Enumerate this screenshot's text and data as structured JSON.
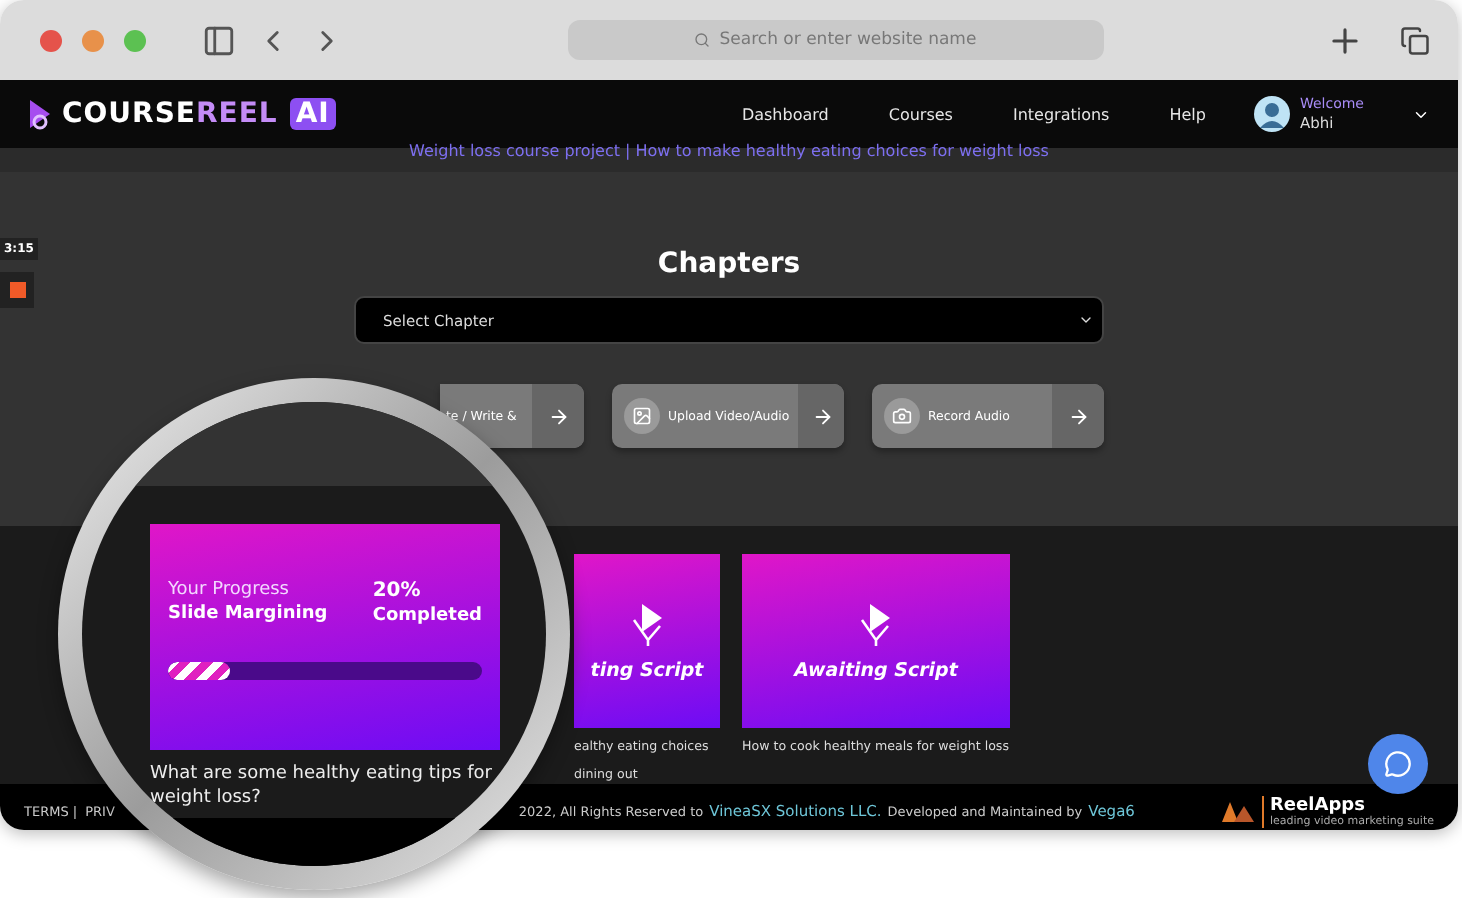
{
  "browser": {
    "address_placeholder": "Search or enter website name"
  },
  "nav": {
    "logo": {
      "part1": "COURSE",
      "part2": "REEL",
      "badge": "AI"
    },
    "links": [
      "Dashboard",
      "Courses",
      "Integrations",
      "Help"
    ],
    "user": {
      "greeting": "Welcome",
      "name": "Abhi"
    }
  },
  "project_title": "Weight loss course project | How to make healthy eating choices for weight loss",
  "recorder": {
    "timer": "3:15"
  },
  "chapters": {
    "title": "Chapters",
    "select_placeholder": "Select Chapter"
  },
  "actions": [
    {
      "kind": "write",
      "label": "te / Write &"
    },
    {
      "kind": "upload",
      "label": "Upload Video/Audio"
    },
    {
      "kind": "record",
      "label": "Record Audio"
    }
  ],
  "cards": [
    {
      "status": "ting Script",
      "caption_lines": [
        "ealthy eating choices",
        "dining out"
      ]
    },
    {
      "status": "Awaiting Script",
      "caption_lines": [
        "How to cook healthy meals for weight loss"
      ]
    }
  ],
  "magnifier": {
    "card": {
      "progress_label": "Your Progress",
      "name": "Slide Margining",
      "percent": "20%",
      "status": "Completed",
      "level": 0.2
    },
    "caption": "What are some healthy eating tips for weight loss?"
  },
  "footer": {
    "links": [
      "TERMS |",
      "PRIV"
    ],
    "copyright": "2022, All Rights Reserved to",
    "company": "VineaSX Solutions LLC.",
    "maintained": "Developed and Maintained by",
    "developer": "Vega6",
    "brand": "ReelApps",
    "brand_tagline": "leading video marketing suite"
  }
}
